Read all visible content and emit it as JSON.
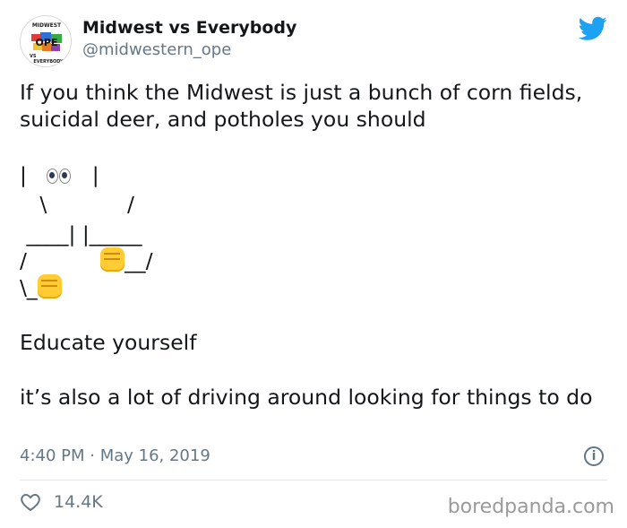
{
  "author": {
    "display_name": "Midwest vs Everybody",
    "handle": "@midwestern_ope"
  },
  "avatar": {
    "ring_top": "MIDWEST",
    "center": "OPE",
    "ring_bottom": "EVERYBODY",
    "vs": "VS"
  },
  "tweet": {
    "line1": "If you think the Midwest is just a bunch of corn fields, suicidal deer, and potholes you should",
    "ascii": {
      "l1a": "|   ",
      "l1b": "   |",
      "l2": "   \\            /",
      "l3": " ____| |_____",
      "l4a": "/           ",
      "l4b": "__/",
      "l5": "\\_"
    },
    "educate": "Educate yourself",
    "also": "it’s also a lot of driving around looking for things to do"
  },
  "meta": {
    "timestamp": "4:40 PM · May 16, 2019"
  },
  "actions": {
    "likes": "14.4K"
  },
  "watermark": "boredpanda.com",
  "colors": {
    "twitter_blue": "#1da1f2",
    "secondary": "#657786"
  },
  "icons": [
    "twitter-bird-icon",
    "eyes-icon",
    "fist-icon",
    "info-icon",
    "heart-icon"
  ]
}
